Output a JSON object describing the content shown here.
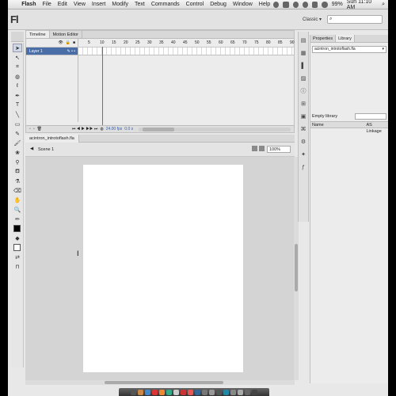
{
  "menubar": {
    "apple": "",
    "app": "Flash",
    "items": [
      "File",
      "Edit",
      "View",
      "Insert",
      "Modify",
      "Text",
      "Commands",
      "Control",
      "Debug",
      "Window",
      "Help"
    ],
    "battery": "99%",
    "clock": "Sun 11:10 AM"
  },
  "titlebar": {
    "logo": "Fl",
    "workspace": "Classic ▾",
    "search_placeholder": "⌕"
  },
  "timeline": {
    "tabs": [
      "Timeline",
      "Motion Editor"
    ],
    "frame_numbers": [
      "5",
      "10",
      "15",
      "20",
      "25",
      "30",
      "35",
      "40",
      "45",
      "50",
      "55",
      "60",
      "65",
      "70",
      "75",
      "80",
      "85",
      "90"
    ],
    "layer_name": "Layer 1",
    "fps": "24.00 fps",
    "time": "0.0 s"
  },
  "document": {
    "tab": "acintron_introtoflash.fla",
    "scene": "Scene 1",
    "zoom": "100%"
  },
  "panel": {
    "tabs": [
      "Properties",
      "Library"
    ],
    "doc_select": "acintron_introtoflash.fla",
    "library_label": "Empty library",
    "columns": [
      "Name",
      "AS Linkage"
    ]
  },
  "colors": {
    "layer_selected": "#4a6ea8",
    "playhead": "#e04040",
    "stage": "#ffffff",
    "pasteboard": "#d4d4d4"
  }
}
